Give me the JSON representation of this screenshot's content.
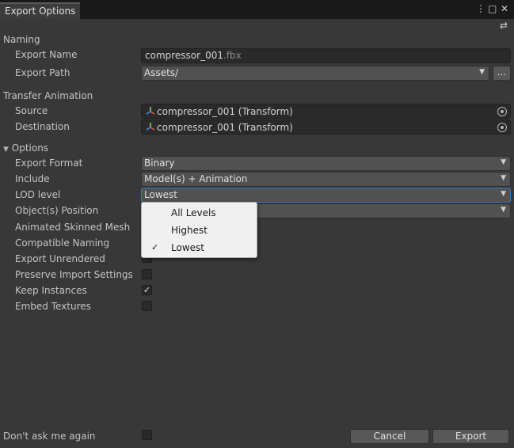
{
  "window": {
    "tab_title": "Export Options",
    "menu_icon": "⋮",
    "maximize_icon": "□",
    "close_icon": "✕",
    "settings_icon": "⇄"
  },
  "naming": {
    "section": "Naming",
    "export_name_label": "Export Name",
    "export_name_value": "compressor_001",
    "export_name_ext": ".fbx",
    "export_path_label": "Export Path",
    "export_path_value": "Assets/",
    "browse_label": "..."
  },
  "transfer": {
    "section": "Transfer Animation",
    "source_label": "Source",
    "source_value": "compressor_001 (Transform)",
    "destination_label": "Destination",
    "destination_value": "compressor_001 (Transform)"
  },
  "options": {
    "section": "Options",
    "export_format_label": "Export Format",
    "export_format_value": "Binary",
    "include_label": "Include",
    "include_value": "Model(s) + Animation",
    "lod_label": "LOD level",
    "lod_value": "Lowest",
    "objects_position_label": "Object(s) Position",
    "animated_skinned_label": "Animated Skinned Mesh",
    "compatible_naming_label": "Compatible Naming",
    "export_unrendered_label": "Export Unrendered",
    "preserve_import_label": "Preserve Import Settings",
    "preserve_import_checked": false,
    "keep_instances_label": "Keep Instances",
    "keep_instances_checked": true,
    "embed_textures_label": "Embed Textures",
    "embed_textures_checked": false
  },
  "lod_dropdown": {
    "items": [
      "All Levels",
      "Highest",
      "Lowest"
    ],
    "selected": "Lowest",
    "check_glyph": "✓"
  },
  "footer": {
    "dont_ask_label": "Don't ask me again",
    "dont_ask_checked": false,
    "cancel_label": "Cancel",
    "export_label": "Export"
  },
  "glyphs": {
    "arrow": "▼",
    "check": "✓",
    "foldout": "▼"
  },
  "colors": {
    "background": "#383838",
    "field": "#2a2a2a",
    "accent": "#3a79bb",
    "popup_bg": "#f0f0f0"
  }
}
